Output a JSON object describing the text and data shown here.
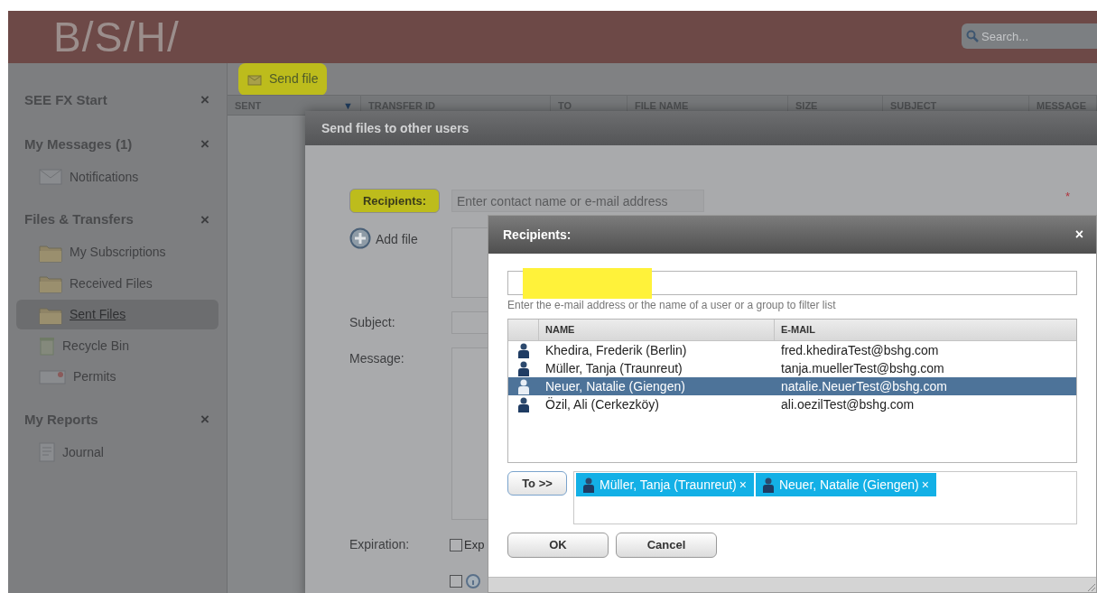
{
  "header": {
    "logo": "B/S/H/",
    "search": {
      "placeholder": "Search..."
    }
  },
  "sidebar": {
    "groups": [
      {
        "title": "SEE FX Start",
        "close": "×"
      },
      {
        "title": "My Messages (1)",
        "close": "×",
        "items": [
          {
            "label": "Notifications",
            "selected": false,
            "kind": "envelope"
          }
        ]
      },
      {
        "title": "Files & Transfers",
        "close": "×",
        "items": [
          {
            "label": "My Subscriptions",
            "selected": false,
            "kind": "folder"
          },
          {
            "label": "Received Files",
            "selected": false,
            "kind": "folder"
          },
          {
            "label": "Sent Files",
            "selected": true,
            "kind": "folder"
          },
          {
            "label": "Recycle Bin",
            "selected": false,
            "kind": "bin"
          },
          {
            "label": "Permits",
            "selected": false,
            "kind": "card"
          }
        ]
      },
      {
        "title": "My Reports",
        "close": "×",
        "items": [
          {
            "label": "Journal",
            "selected": false,
            "kind": "report"
          }
        ]
      }
    ]
  },
  "toolbar": {
    "send_button": {
      "label": "Send file",
      "highlighted": true
    }
  },
  "table": {
    "sort_mark": "▼",
    "columns": [
      "SENT",
      "TRANSFER ID",
      "TO",
      "FILE NAME",
      "SIZE",
      "SUBJECT",
      "MESSAGE"
    ]
  },
  "send_dialog": {
    "title": "Send files to other users",
    "recipients_button": {
      "label": "Recipients:",
      "highlighted": true
    },
    "recipients_field": {
      "placeholder": "Enter contact name or e-mail address"
    },
    "required_mark": "*",
    "add_file": "Add file",
    "subject_label": "Subject:",
    "message_label": "Message:",
    "expiration_label": "Expiration:",
    "expiration_checkbox": {
      "label": "Exp",
      "checked": false
    },
    "extra_checkbox": {
      "checked": false
    }
  },
  "recipients_dialog": {
    "title": "Recipients:",
    "close": "×",
    "filter": {
      "highlighted": true
    },
    "hint": "Enter the e-mail address or the name of a user or a group to filter list",
    "columns": [
      "NAME",
      "E-MAIL"
    ],
    "rows": [
      {
        "name": "Khedira, Frederik (Berlin)",
        "email": "fred.khediraTest@bshg.com",
        "selected": false
      },
      {
        "name": "Müller, Tanja (Traunreut)",
        "email": "tanja.muellerTest@bshg.com",
        "selected": false
      },
      {
        "name": "Neuer, Natalie (Giengen)",
        "email": "natalie.NeuerTest@bshg.com",
        "selected": true
      },
      {
        "name": "Özil, Ali (Cerkezköy)",
        "email": "ali.oezilTest@bshg.com",
        "selected": false
      }
    ],
    "to_button": "To >>",
    "chips": [
      {
        "label": "Müller, Tanja (Traunreut)",
        "remove": "×"
      },
      {
        "label": "Neuer, Natalie (Giengen)",
        "remove": "×"
      }
    ],
    "ok": "OK",
    "cancel": "Cancel"
  }
}
